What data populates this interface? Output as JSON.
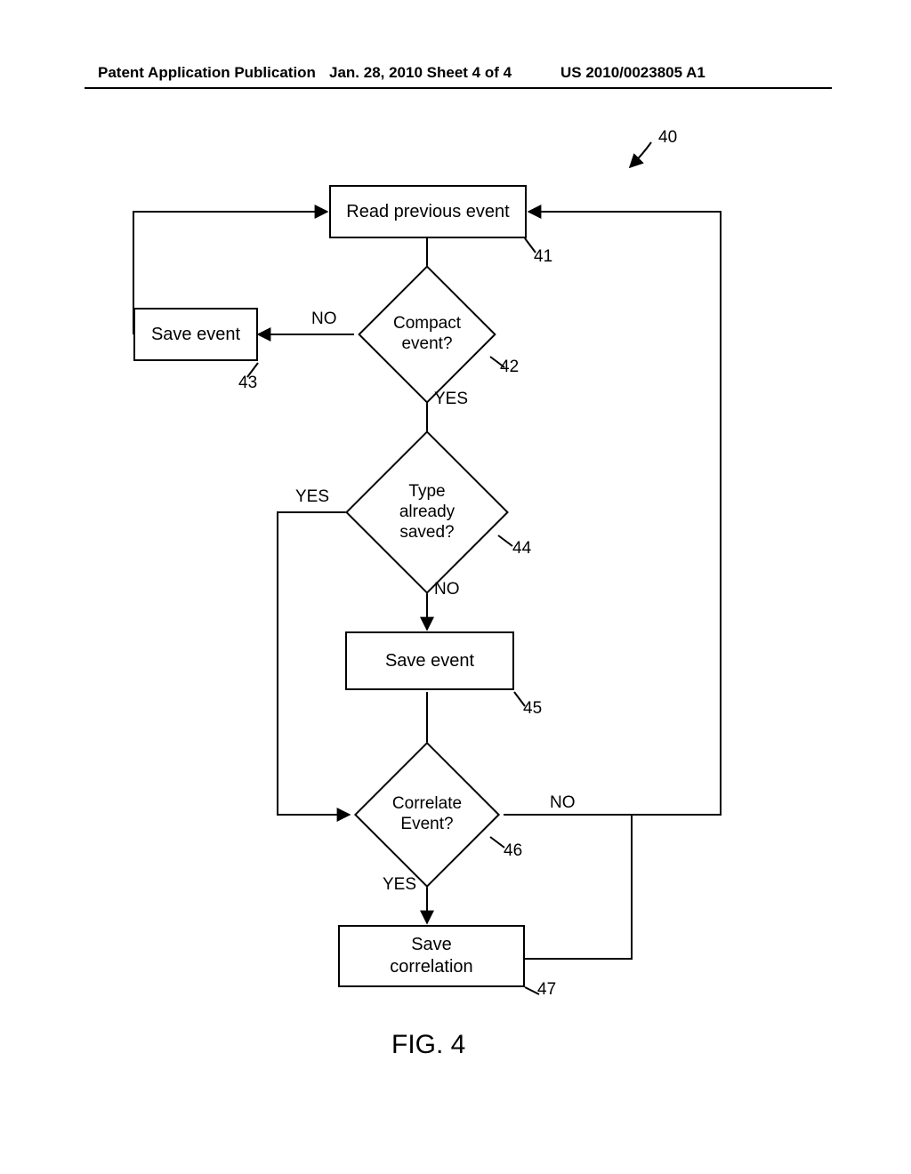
{
  "header": {
    "left": "Patent Application Publication",
    "mid": "Jan. 28, 2010  Sheet 4 of 4",
    "right": "US 2010/0023805 A1"
  },
  "ref": {
    "r40": "40",
    "r41": "41",
    "r42": "42",
    "r43": "43",
    "r44": "44",
    "r45": "45",
    "r46": "46",
    "r47": "47"
  },
  "nodes": {
    "read_prev": "Read previous event",
    "compact_q": "Compact\nevent?",
    "save_left": "Save event",
    "type_saved_q": "Type\nalready\nsaved?",
    "save_mid": "Save event",
    "correlate_q": "Correlate\nEvent?",
    "save_corr": "Save\ncorrelation"
  },
  "edges": {
    "no": "NO",
    "yes": "YES"
  },
  "caption": "FIG. 4"
}
